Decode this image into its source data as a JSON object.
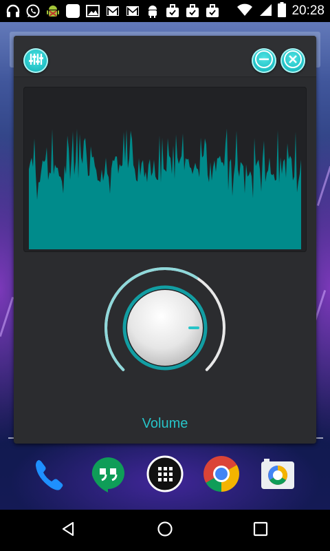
{
  "status_bar": {
    "clock": "20:28",
    "notification_icons": [
      "headset-icon",
      "whatsapp-icon",
      "android-bug-icon",
      "app-square-icon",
      "image-icon",
      "gmail-icon",
      "gmail-icon",
      "android-icon",
      "briefcase-check-icon",
      "briefcase-check-icon",
      "briefcase-check-icon"
    ],
    "system_icons": [
      "wifi-icon",
      "signal-icon",
      "battery-icon"
    ]
  },
  "widget": {
    "header": {
      "equalizer_button": "equalizer-icon",
      "minimize_button": "minimize-icon",
      "close_button": "close-icon"
    },
    "knob": {
      "level_percent": 62
    },
    "volume_label": "Volume",
    "colors": {
      "accent": "#27c4c8",
      "panel": "#2b2c2f",
      "waveform": "#008b8b"
    }
  },
  "dock": {
    "apps": [
      "phone-icon",
      "hangouts-icon",
      "app-drawer-icon",
      "chrome-icon",
      "camera-icon"
    ]
  },
  "nav_bar": {
    "buttons": [
      "back-icon",
      "home-icon",
      "recents-icon"
    ]
  }
}
